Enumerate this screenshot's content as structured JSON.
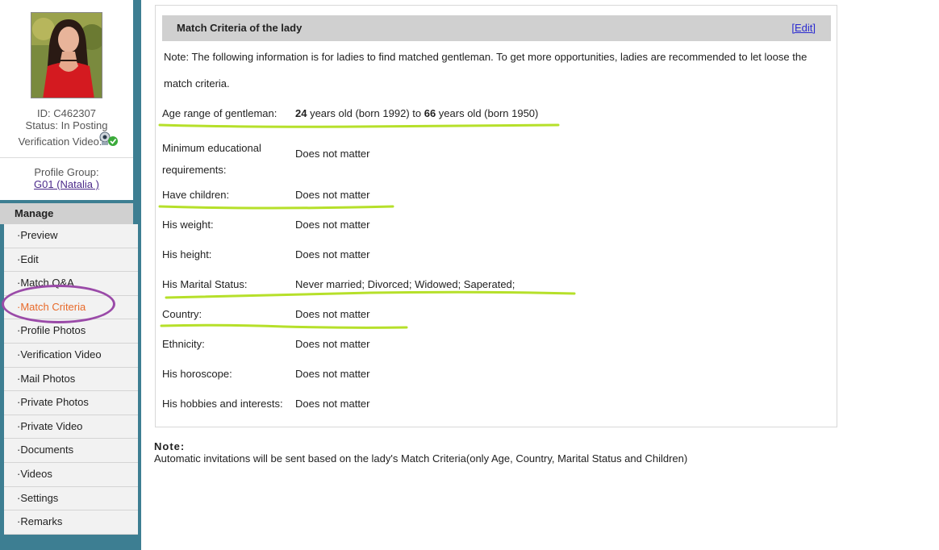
{
  "profile": {
    "id_label": "ID: C462307",
    "status_label": "Status: In Posting",
    "verification_label": "Verification Video:",
    "group_label": "Profile Group:",
    "group_link": "G01 (Natalia )"
  },
  "sidebar": {
    "manage_label": "Manage",
    "items": [
      {
        "label": "·Preview"
      },
      {
        "label": "·Edit"
      },
      {
        "label": "·Match Q&A"
      },
      {
        "label": "·Match Criteria"
      },
      {
        "label": "·Profile Photos"
      },
      {
        "label": "·Verification Video"
      },
      {
        "label": "·Mail Photos"
      },
      {
        "label": "·Private Photos"
      },
      {
        "label": "·Private Video"
      },
      {
        "label": "·Documents"
      },
      {
        "label": "·Videos"
      },
      {
        "label": "·Settings"
      },
      {
        "label": "·Remarks"
      }
    ],
    "active_index": 3
  },
  "panel": {
    "title": "Match Criteria of the lady",
    "edit_label": "[Edit]",
    "note": "Note: The following information is for ladies to find matched gentleman. To get more opportunities, ladies are recommended to let loose the match criteria."
  },
  "criteria": {
    "age": {
      "label": "Age range of gentleman:",
      "min_age": "24",
      "min_text": " years old (born 1992) to ",
      "max_age": "66",
      "max_text": " years old (born 1950)"
    },
    "education": {
      "label": "Minimum educational requirements:",
      "value": "Does not matter"
    },
    "children": {
      "label": "Have children:",
      "value": "Does not matter"
    },
    "weight": {
      "label": "His weight:",
      "value": "Does not matter"
    },
    "height": {
      "label": "His height:",
      "value": "Does not matter"
    },
    "marital": {
      "label": "His Marital Status:",
      "value": "Never married; Divorced; Widowed; Saperated;"
    },
    "country": {
      "label": "Country:",
      "value": "Does not matter"
    },
    "ethnicity": {
      "label": "Ethnicity:",
      "value": "Does not matter"
    },
    "horoscope": {
      "label": "His horoscope:",
      "value": "Does not matter"
    },
    "hobbies": {
      "label": "His hobbies and interests:",
      "value": "Does not matter"
    }
  },
  "footer": {
    "note_title": "Note:",
    "note_text": "Automatic invitations will be sent based on the lady's Match Criteria(only Age, Country, Marital Status and Children)"
  },
  "colors": {
    "sidebar_bg": "#3d7e92",
    "active_item": "#e86a2a",
    "highlight_line": "#b6e02a",
    "circle_mark": "#9a4aa8",
    "link": "#2a2ad0"
  }
}
